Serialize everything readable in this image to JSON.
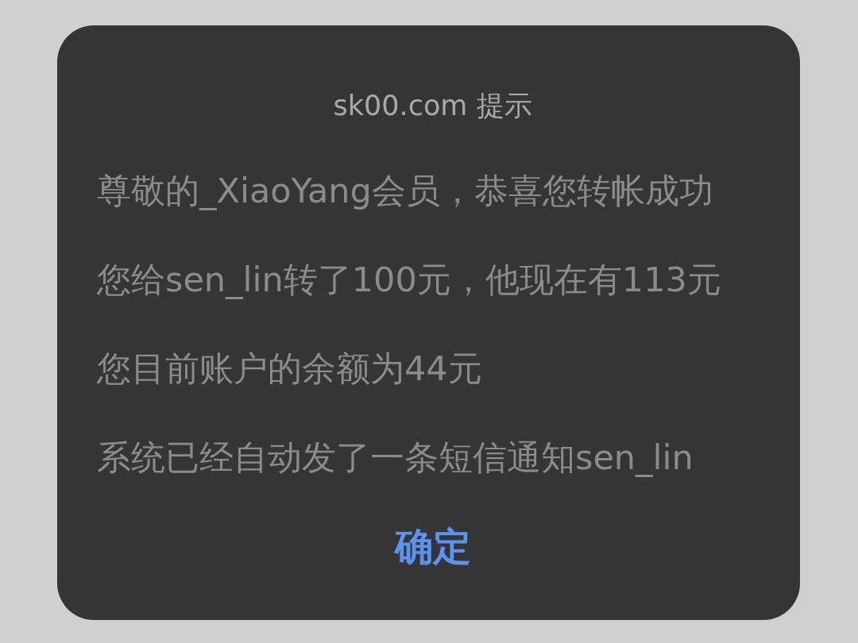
{
  "dialog": {
    "title": "sk00.com 提示",
    "message_lines": [
      "尊敬的_XiaoYang会员，恭喜您转帐成功",
      "您给sen_lin转了100元，他现在有113元",
      "您目前账户的余额为44元",
      "系统已经自动发了一条短信通知sen_lin"
    ],
    "button": "确定"
  }
}
